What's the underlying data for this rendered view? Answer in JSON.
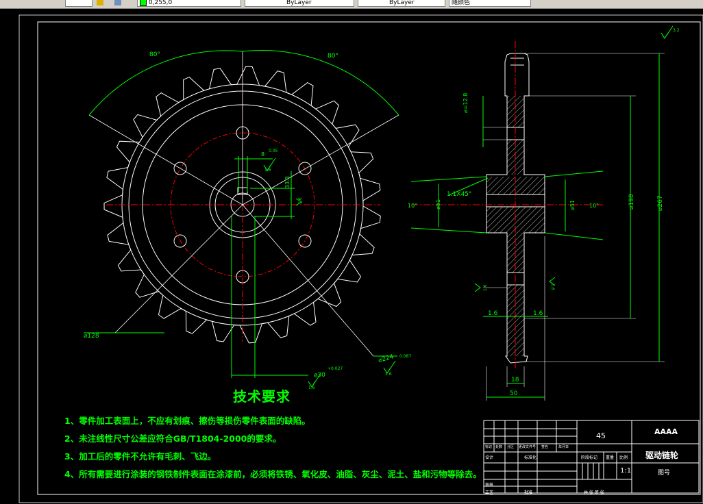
{
  "toolbar": {
    "coord_value": "0,255,0",
    "linetype_1": "ByLayer",
    "linetype_2": "ByLayer",
    "color_field": "随颜色"
  },
  "drawing": {
    "dim_angle_left": "80°",
    "dim_angle_right": "80°",
    "dim_d128": "⌀128",
    "dim_d224": "⌀224",
    "dim_d224_tol": "0.087",
    "dim_d30": "⌀30",
    "dim_d30_tol": "+0.027",
    "dim_keyway_w": "8",
    "dim_keyway_tol": "0.05",
    "dim_keyway_h": "33.3",
    "dim_roughness_1": "1.6",
    "dim_roughness_2": "1.6",
    "dim_roughness_3": "1.6",
    "dim_roughness_4": "1.6",
    "dim_roughness_5": "1.6",
    "dim_roughness_6": "1.6",
    "dim_chamfer": "1.1X45°",
    "dim_d51_left": "⌀51",
    "dim_d51_right": "⌀51",
    "dim_10_left": "10°",
    "dim_10_right": "10°",
    "dim_d198": "⌀198",
    "dim_d267": "⌀267",
    "dim_d12_8": "⌀=12.8",
    "dim_18": "18",
    "dim_50": "50",
    "dim_side_1_6_l": "1.6",
    "dim_side_1_6_r": "1.6",
    "dim_top_roughness": "3.2"
  },
  "tech": {
    "title": "技术要求",
    "items": [
      "1、零件加工表面上，不应有划痕、擦伤等损伤零件表面的缺陷。",
      "2、未注线性尺寸公差应符合GB/T1804-2000的要求。",
      "3、加工后的零件不允许有毛刺、飞边。",
      "4、所有需要进行涂装的钢铁制件表面在涂漆前，必须将铁锈、氧化皮、油脂、灰尘、泥土、盐和污物等除去。"
    ]
  },
  "title_block": {
    "material": "45",
    "company": "AAAA",
    "part_name": "驱动链轮",
    "scale": "1:1",
    "drawing_no": "图号",
    "row_labels": [
      "标记",
      "处数",
      "分区",
      "更改文件号",
      "签名",
      "年月日"
    ],
    "design": "设计",
    "standard": "标准化",
    "stage": "阶段标记",
    "weight": "重量",
    "ratio": "比例",
    "review": "审核",
    "process": "工艺",
    "approve": "批准",
    "sheet": "共  张  第  张"
  }
}
